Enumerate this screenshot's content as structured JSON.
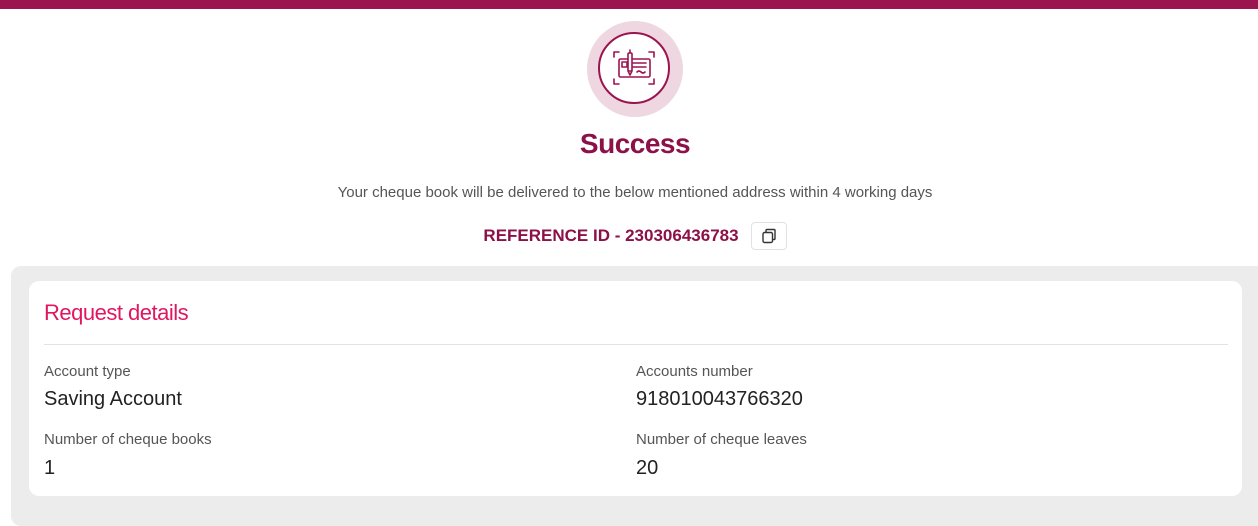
{
  "header": {
    "accent_color": "#9b1450",
    "icon": "cheque-book-icon"
  },
  "status": {
    "title": "Success",
    "message": "Your cheque book will be delivered to the below mentioned address within 4 working days",
    "reference": "REFERENCE ID - 230306436783",
    "copy_icon": "copy-icon"
  },
  "request_details": {
    "title": "Request details",
    "title_color": "#e0175f",
    "fields": [
      {
        "label": "Account type",
        "value": "Saving Account"
      },
      {
        "label": "Accounts number",
        "value": "918010043766320"
      },
      {
        "label": "Number of cheque books",
        "value": "1"
      },
      {
        "label": "Number of cheque leaves",
        "value": "20"
      }
    ]
  }
}
